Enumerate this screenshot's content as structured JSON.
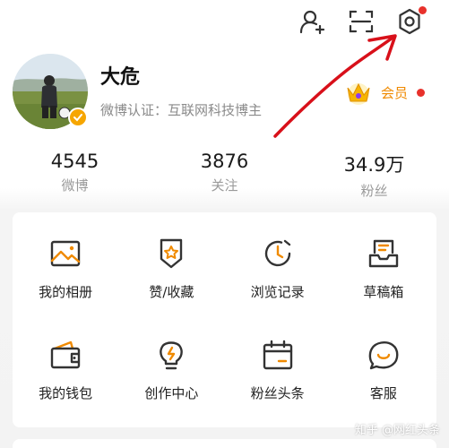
{
  "header": {
    "icons": [
      {
        "name": "add-friend-icon",
        "badge": false
      },
      {
        "name": "scan-icon",
        "badge": false
      },
      {
        "name": "settings-icon",
        "badge": true
      }
    ]
  },
  "profile": {
    "username": "大危",
    "verification": "微博认证：互联网科技博主",
    "member_label": "会员",
    "member_badge": true
  },
  "stats": [
    {
      "value": "4545",
      "label": "微博"
    },
    {
      "value": "3876",
      "label": "关注"
    },
    {
      "value": "34.9万",
      "label": "粉丝"
    }
  ],
  "menu": [
    {
      "label": "我的相册",
      "icon": "photo-album-icon"
    },
    {
      "label": "赞/收藏",
      "icon": "favorite-icon"
    },
    {
      "label": "浏览记录",
      "icon": "history-clock-icon"
    },
    {
      "label": "草稿箱",
      "icon": "drafts-tray-icon"
    },
    {
      "label": "我的钱包",
      "icon": "wallet-icon"
    },
    {
      "label": "创作中心",
      "icon": "lightbulb-icon"
    },
    {
      "label": "粉丝头条",
      "icon": "calendar-icon"
    },
    {
      "label": "客服",
      "icon": "chat-smile-icon"
    }
  ],
  "watermark": "知乎 @网红头条",
  "colors": {
    "accent": "#f08a00",
    "icon_orange": "#f08a00",
    "icon_dark": "#333333",
    "alert_red": "#e8312b",
    "annotation_red": "#d8101a"
  }
}
